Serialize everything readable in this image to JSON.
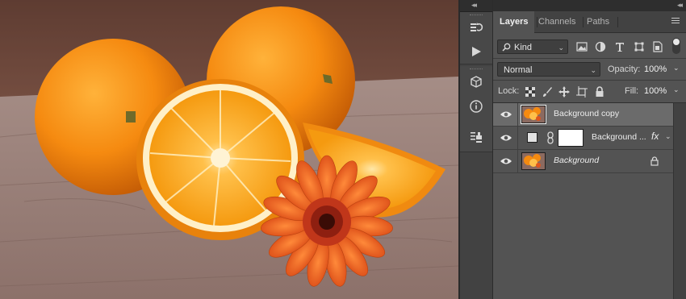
{
  "canvas": {
    "description_icon": "photo-canvas"
  },
  "dock": {
    "collapse_glyph": "◂◂",
    "buttons": [
      "history-icon",
      "actions-play-icon",
      "3d-cube-icon",
      "info-icon",
      "clone-source-icon"
    ]
  },
  "panel": {
    "collapse_glyph": "◂◂",
    "tabs": [
      "Layers",
      "Channels",
      "Paths"
    ],
    "active_tab": "Layers",
    "filter": {
      "value": "Kind"
    },
    "blend_mode": {
      "value": "Normal"
    },
    "opacity": {
      "label": "Opacity:",
      "value": "100%"
    },
    "lock": {
      "label": "Lock:"
    },
    "fill": {
      "label": "Fill:",
      "value": "100%"
    },
    "layers": [
      {
        "name": "Background copy",
        "selected": true,
        "italic": false
      },
      {
        "name": "Background ...",
        "selected": false,
        "italic": false,
        "fx": "fx"
      },
      {
        "name": "Background",
        "selected": false,
        "italic": true,
        "locked": true
      }
    ]
  },
  "colors": {
    "panel_bg": "#535353",
    "selected_row": "#6b6b6b",
    "dark_bar": "#424242",
    "accent_orange": "#f28a1a"
  }
}
